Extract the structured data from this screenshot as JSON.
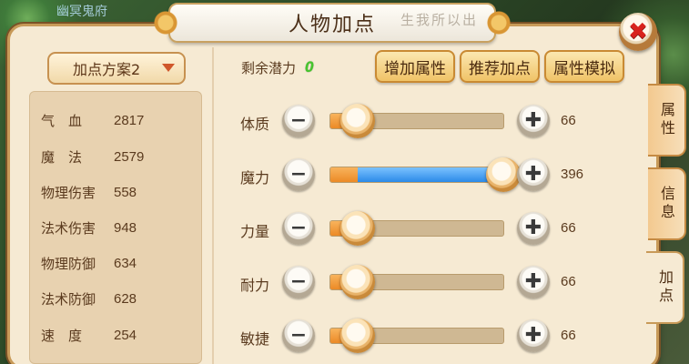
{
  "window": {
    "title": "人物加点",
    "title_calligraphy": "生我所以出",
    "close_icon": "✖",
    "top_left_text": "幽冥鬼府"
  },
  "plan": {
    "selected": "加点方案2"
  },
  "stats": [
    {
      "label": "气　血",
      "value": "2817"
    },
    {
      "label": "魔　法",
      "value": "2579"
    },
    {
      "label": "物理伤害",
      "value": "558"
    },
    {
      "label": "法术伤害",
      "value": "948"
    },
    {
      "label": "物理防御",
      "value": "634"
    },
    {
      "label": "法术防御",
      "value": "628"
    },
    {
      "label": "速　度",
      "value": "254"
    }
  ],
  "potential": {
    "label": "剩余潜力",
    "value": "0"
  },
  "actions": {
    "add_attribute": "增加属性",
    "recommended": "推荐加点",
    "simulate": "属性模拟"
  },
  "attributes": [
    {
      "label": "体质",
      "value": "66",
      "base_fraction": 0.16,
      "alloc_fraction": 0.0
    },
    {
      "label": "魔力",
      "value": "396",
      "base_fraction": 0.16,
      "alloc_fraction": 0.84
    },
    {
      "label": "力量",
      "value": "66",
      "base_fraction": 0.16,
      "alloc_fraction": 0.0
    },
    {
      "label": "耐力",
      "value": "66",
      "base_fraction": 0.16,
      "alloc_fraction": 0.0
    },
    {
      "label": "敏捷",
      "value": "66",
      "base_fraction": 0.16,
      "alloc_fraction": 0.0
    }
  ],
  "controls": {
    "minus_symbol": "−",
    "plus_symbol": "✚"
  },
  "side_tabs": [
    {
      "label": "属性",
      "active": false
    },
    {
      "label": "信息",
      "active": false
    },
    {
      "label": "加点",
      "active": true
    }
  ],
  "colors": {
    "fill_base": "#ec8a26",
    "fill_alloc": "#2c8ae8",
    "potential_value": "#45c62c",
    "close_x": "#d8231d"
  }
}
